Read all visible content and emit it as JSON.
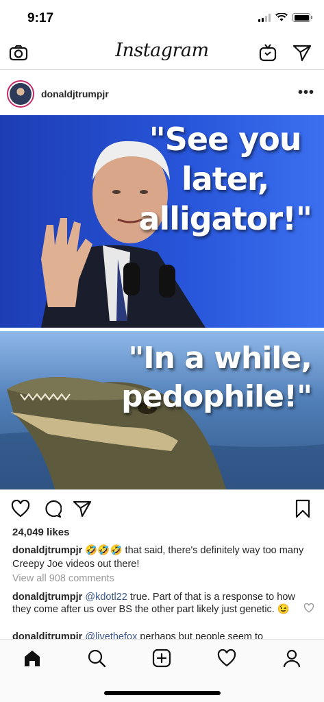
{
  "status_bar": {
    "time": "9:17"
  },
  "header": {
    "logo": "Instagram",
    "icons": [
      "camera-icon",
      "igtv-icon",
      "direct-message-icon"
    ]
  },
  "post": {
    "username": "donaldjtrumpjr",
    "more_label": "•••",
    "meme": {
      "top_caption_lines": [
        "\"See you",
        "later,",
        "alligator!\""
      ],
      "bottom_caption_lines": [
        "\"In a while,",
        "pedophile!\""
      ]
    },
    "likes": "24,049 likes",
    "caption": {
      "username": "donaldjtrumpjr",
      "emojis": "🤣🤣🤣",
      "text": "that said, there's definitely way too many Creepy Joe videos out there!"
    },
    "view_all_comments": "View all 908 comments",
    "comments": [
      {
        "username": "donaldjtrumpjr",
        "mention": "@kdotl22",
        "text": "true. Part of that is a response to how they come after us over BS the other part likely just genetic. 😉"
      },
      {
        "username": "donaldjtrumpjr",
        "mention": "@livethefox",
        "text": "perhaps but people seem to"
      }
    ]
  },
  "bottom_nav": {
    "items": [
      "home-icon",
      "search-icon",
      "add-post-icon",
      "activity-heart-icon",
      "profile-icon"
    ]
  },
  "colors": {
    "accent_blue": "#2754d8",
    "mention": "#3a5a8c",
    "muted": "#999999"
  }
}
